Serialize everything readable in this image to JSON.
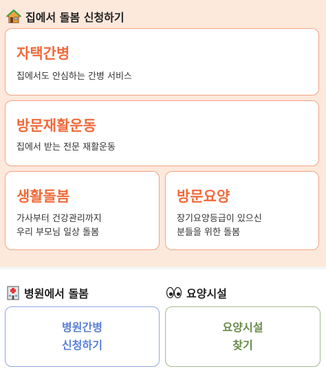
{
  "home_section": {
    "title": "집에서 돌봄 신청하기",
    "icon": "house-icon",
    "cards": [
      {
        "title": "자택간병",
        "desc_lines": [
          "집에서도 안심하는 간병 서비스"
        ]
      },
      {
        "title": "방문재활운동",
        "desc_lines": [
          "집에서 받는 전문 재활운동"
        ]
      },
      {
        "title": "생활돌봄",
        "desc_lines": [
          "가사부터 건강관리까지",
          "우리 부모님 일상 돌봄"
        ]
      },
      {
        "title": "방문요양",
        "desc_lines": [
          "장기요양등급이 있으신",
          "분들을 위한 돌봄"
        ]
      }
    ]
  },
  "hospital_section": {
    "title": "병원에서 돌봄",
    "icon": "hospital-icon",
    "button_lines": [
      "병원간병",
      "신청하기"
    ]
  },
  "facility_section": {
    "title": "요양시설",
    "icon": "eyes-icon",
    "button_lines": [
      "요양시설",
      "찾기"
    ]
  },
  "colors": {
    "accent_orange": "#f06a3a",
    "card_border": "#f3a383",
    "top_background": "#fde8dc",
    "blue_button": "#5a7fd6",
    "green_button": "#6a8b48"
  }
}
